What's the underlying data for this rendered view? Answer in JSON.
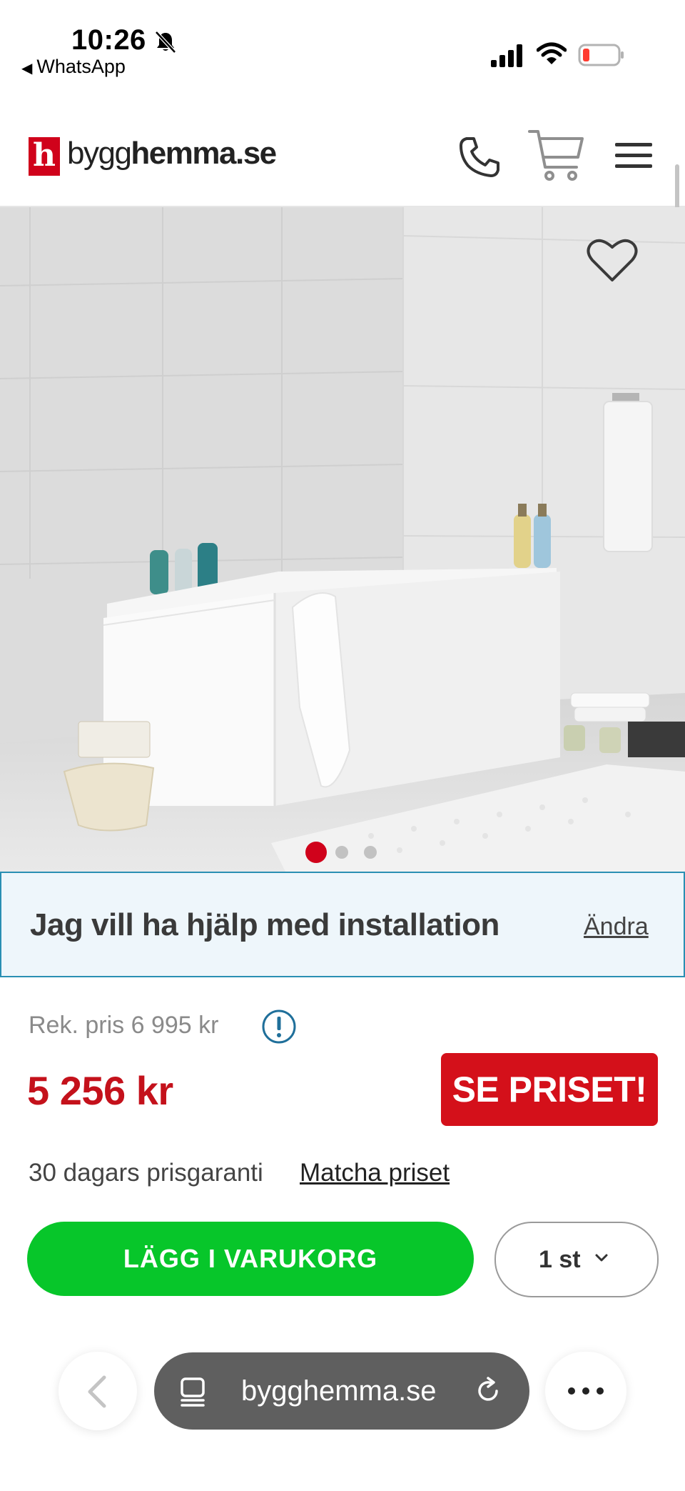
{
  "status_bar": {
    "time": "10:26",
    "back_app": "WhatsApp"
  },
  "header": {
    "logo_letter": "h",
    "logo_light": "bygg",
    "logo_bold": "hemma.se"
  },
  "gallery": {
    "image_count": 3,
    "active_index": 0
  },
  "installation": {
    "text": "Jag vill ha hjälp med installation",
    "change_link": "Ändra"
  },
  "price": {
    "recommended": "Rek. pris 6 995 kr",
    "current": "5 256 kr",
    "see_price_button": "SE PRISET!",
    "guarantee": "30 dagars prisgaranti",
    "match_link": "Matcha priset"
  },
  "cart": {
    "add_button": "LÄGG I VARUKORG",
    "quantity": "1 st"
  },
  "browser": {
    "url": "bygghemma.se"
  },
  "colors": {
    "brand_red": "#d0021b",
    "price_red": "#c4111b",
    "add_to_cart_green": "#07c62a",
    "install_border": "#2a8fb3",
    "install_bg": "#eef6fb"
  },
  "icons": [
    "bell-slash-icon",
    "signal-icon",
    "wifi-icon",
    "battery-icon",
    "phone-icon",
    "cart-icon",
    "menu-icon",
    "heart-icon",
    "info-icon",
    "chevron-down-icon",
    "back-arrow-icon",
    "tabs-icon",
    "reload-icon",
    "more-icon"
  ]
}
